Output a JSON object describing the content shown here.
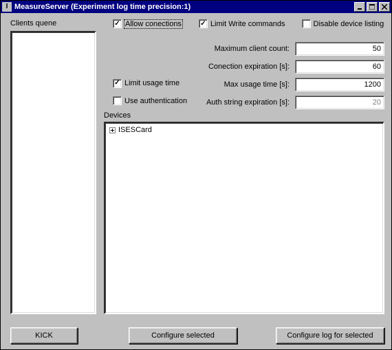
{
  "window": {
    "title": "MeasureServer (Experiment log time precision:1)"
  },
  "labels": {
    "clients_queue": "Clients quene",
    "devices": "Devices"
  },
  "checkboxes": {
    "allow_connections": {
      "label": "Allow conections",
      "checked": "✓"
    },
    "limit_write": {
      "label": "Limit Write commands",
      "checked": "✓"
    },
    "disable_listing": {
      "label": "Disable device listing",
      "checked": ""
    },
    "limit_usage": {
      "label": "Limit usage time",
      "checked": "✓"
    },
    "use_auth": {
      "label": "Use authentication",
      "checked": ""
    }
  },
  "fields": {
    "max_client_count": {
      "label": "Maximum client count:",
      "value": "50"
    },
    "conn_expiration": {
      "label": "Conection expiration [s]:",
      "value": "60"
    },
    "max_usage_time": {
      "label": "Max usage time [s]:",
      "value": "1200"
    },
    "auth_expiration": {
      "label": "Auth string expiration [s]:",
      "value": "20"
    }
  },
  "devices": {
    "items": [
      "ISESCard"
    ]
  },
  "buttons": {
    "kick": "KICK",
    "configure_selected": "Configure selected",
    "configure_log": "Configure log for selected"
  }
}
